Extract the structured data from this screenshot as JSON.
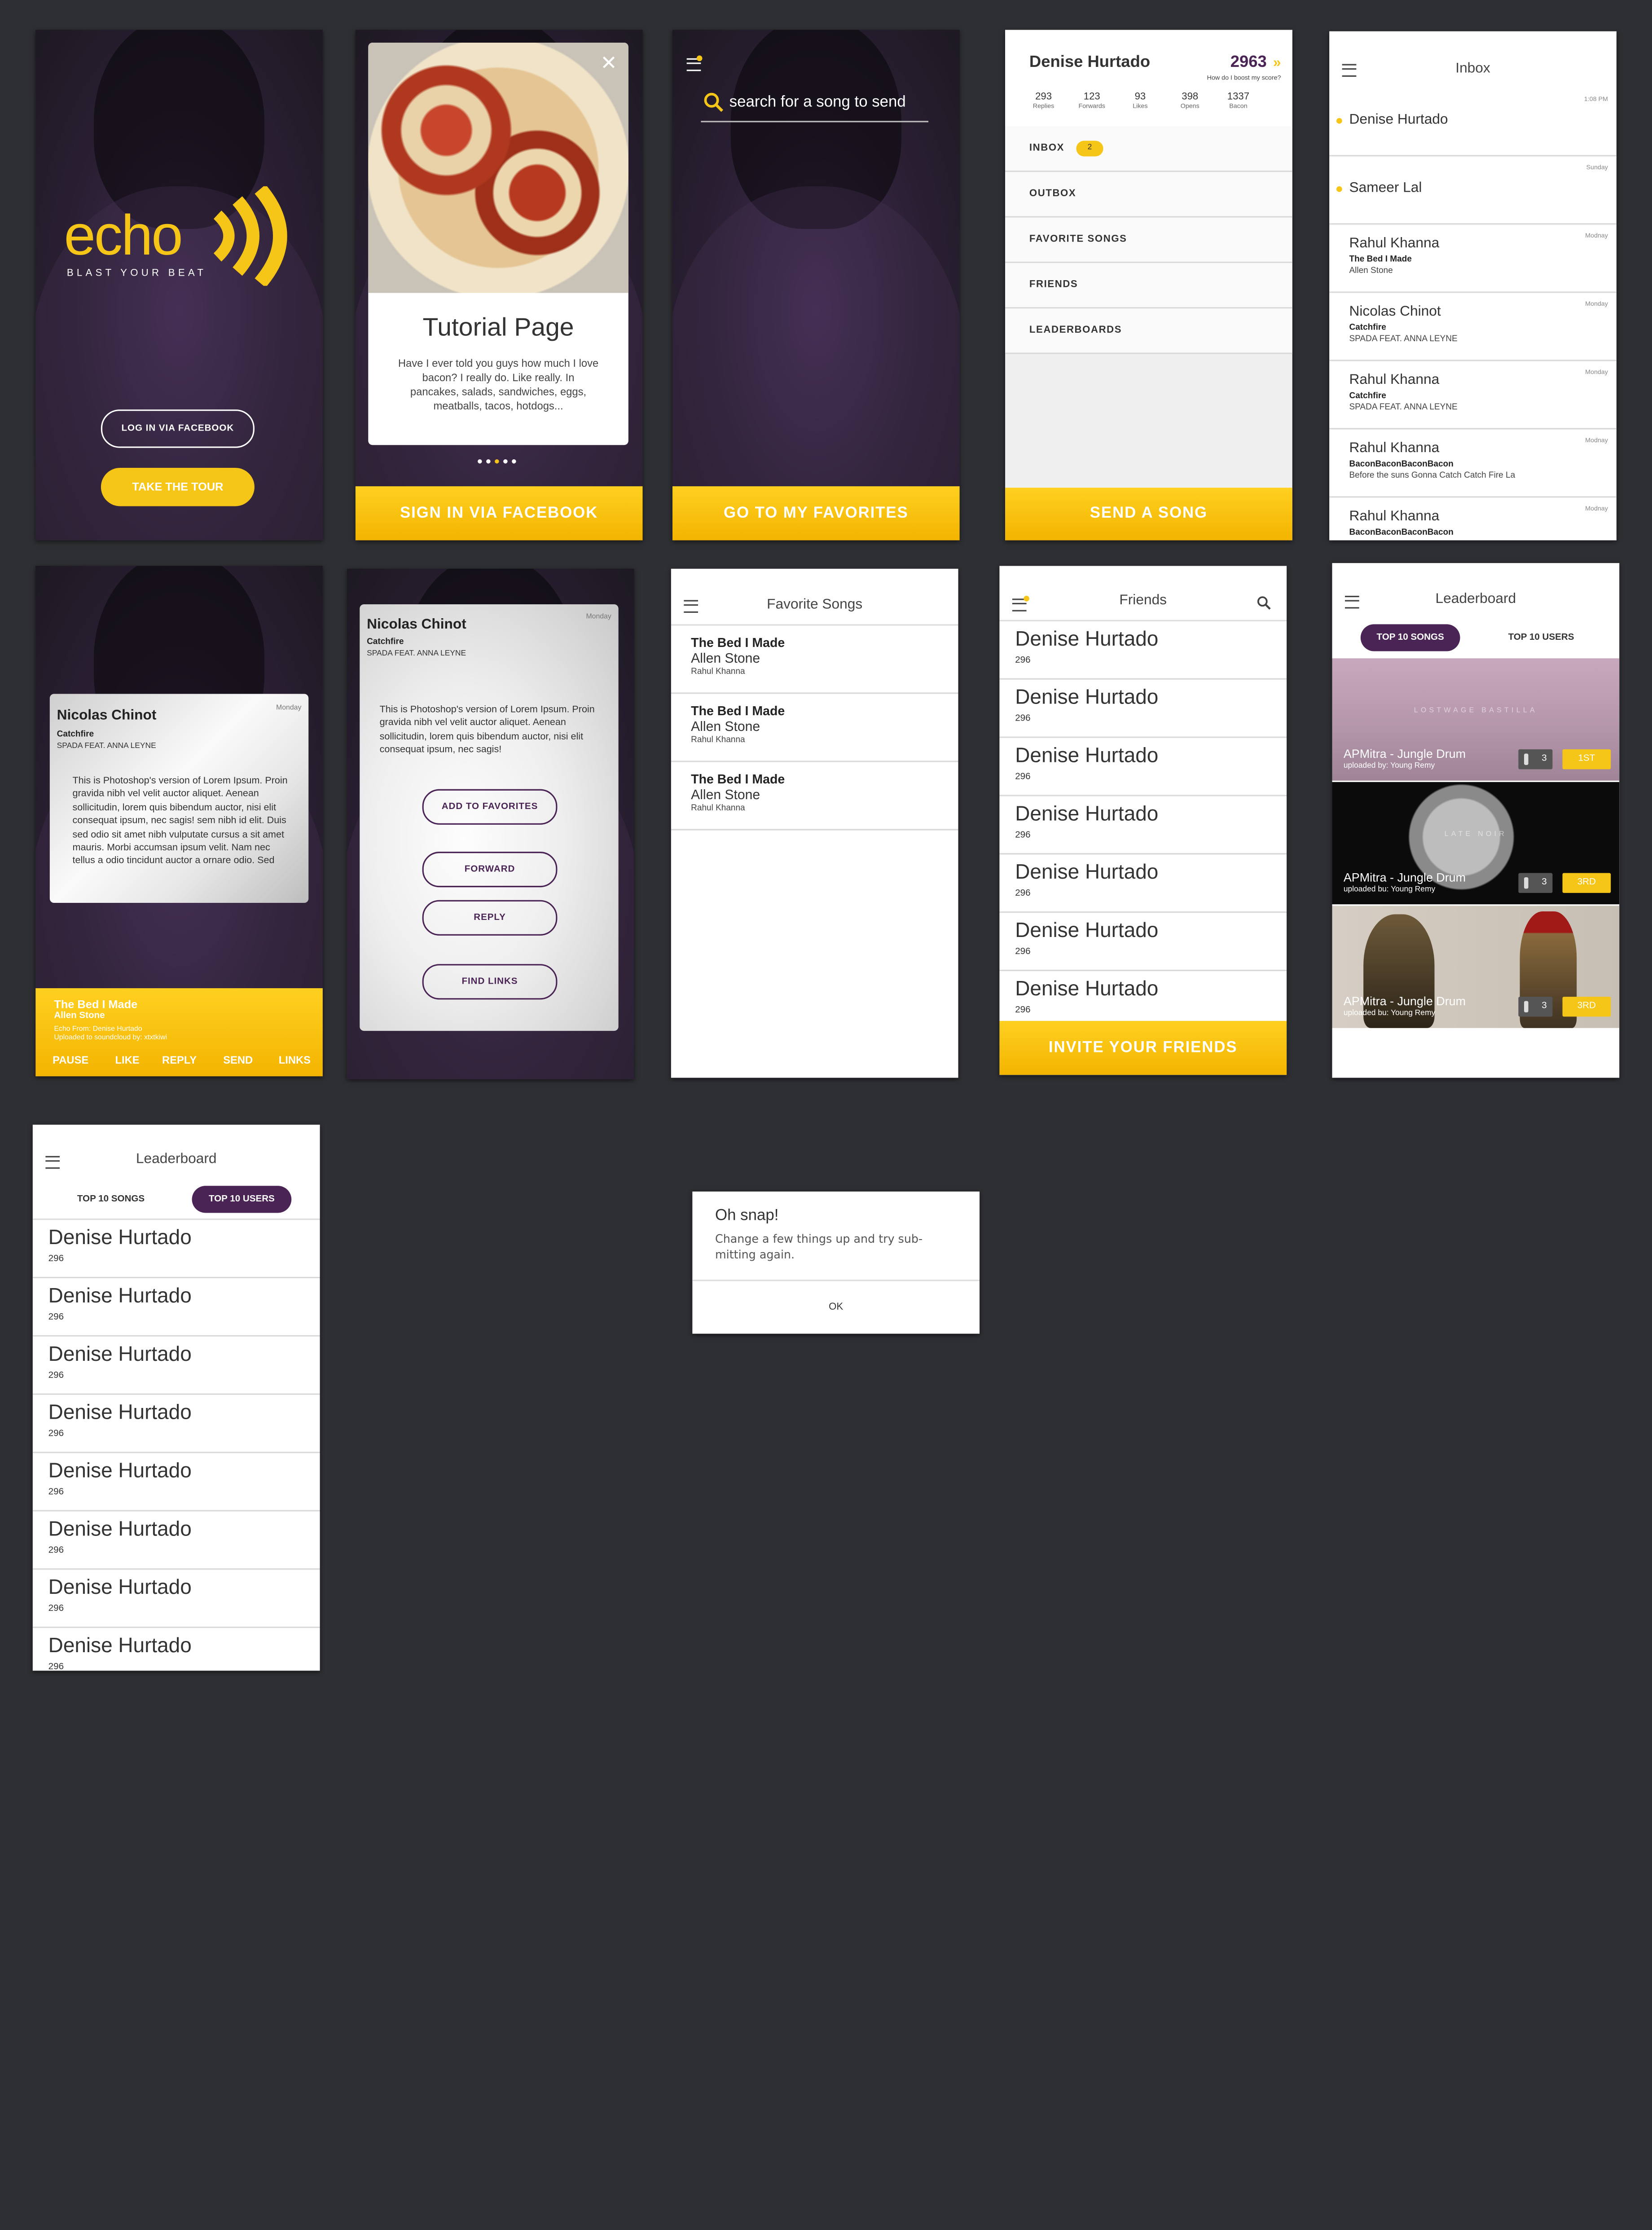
{
  "colors": {
    "accent": "#f5c518",
    "brand_purple": "#4a2454",
    "canvas": "#2e2f33"
  },
  "login": {
    "logo_word": "echo",
    "tagline": "BLAST YOUR BEAT",
    "facebook_button": "LOG IN VIA FACEBOOK",
    "tour_button": "TAKE THE TOUR"
  },
  "tutorial": {
    "title": "Tutorial Page",
    "body": "Have I ever told you guys how much I love bacon? I really do. Like really. In pancakes, salads, sandwiches, eggs, meatballs, tacos, hotdogs...",
    "close_icon": "close-icon",
    "page_dots": 5,
    "cta": "SIGN IN VIA FACEBOOK"
  },
  "search": {
    "placeholder": "search for a song to send",
    "cta": "GO TO MY FAVORITES"
  },
  "menu": {
    "user": "Denise Hurtado",
    "score": "2963",
    "score_hint": "How do I boost my score?",
    "stats": [
      {
        "value": "293",
        "label": "Replies"
      },
      {
        "value": "123",
        "label": "Forwards"
      },
      {
        "value": "93",
        "label": "Likes"
      },
      {
        "value": "398",
        "label": "Opens"
      },
      {
        "value": "1337",
        "label": "Bacon"
      }
    ],
    "items": [
      "INBOX",
      "OUTBOX",
      "FAVORITE SONGS",
      "FRIENDS",
      "LEADERBOARDS"
    ],
    "inbox_badge": "2",
    "cta": "SEND A SONG"
  },
  "inbox": {
    "title": "Inbox",
    "items": [
      {
        "name": "Denise Hurtado",
        "time": "1:08 PM",
        "song": "",
        "artist": "",
        "unread": true
      },
      {
        "name": "Sameer Lal",
        "time": "Sunday",
        "song": "",
        "artist": "",
        "unread": true
      },
      {
        "name": "Rahul Khanna",
        "time": "Modnay",
        "song": "The Bed I Made",
        "artist": "Allen Stone",
        "unread": false
      },
      {
        "name": "Nicolas Chinot",
        "time": "Monday",
        "song": "Catchfire",
        "artist": "SPADA FEAT. ANNA LEYNE",
        "unread": false
      },
      {
        "name": "Rahul Khanna",
        "time": "Monday",
        "song": "Catchfire",
        "artist": "SPADA FEAT. ANNA LEYNE",
        "unread": false
      },
      {
        "name": "Rahul Khanna",
        "time": "Modnay",
        "song": "BaconBaconBaconBacon",
        "artist": "Before the suns Gonna Catch Catch Fire La",
        "unread": false
      },
      {
        "name": "Rahul Khanna",
        "time": "Modnay",
        "song": "BaconBaconBaconBacon",
        "artist": "",
        "unread": false
      }
    ]
  },
  "message": {
    "name": "Nicolas Chinot",
    "day": "Monday",
    "song": "Catchfire",
    "artist": "SPADA FEAT. ANNA LEYNE",
    "body": "This is Photoshop's version  of Lorem Ipsum. Proin gravida nibh vel velit auctor aliquet. Aenean sollicitudin, lorem quis bibendum auctor, nisi elit consequat ipsum, nec sagis! sem nibh id elit. Duis sed odio sit amet nibh vulputate cursus a sit amet mauris. Morbi accumsan ipsum velit. Nam nec tellus a odio tincidunt auctor a ornare odio. Sed",
    "player": {
      "song": "The Bed I Made",
      "artist": "Allen Stone",
      "from": "Echo From: Denise Hurtado",
      "uploaded": "Uploaded to soundcloud by: xtxtkiwi",
      "controls": [
        "PAUSE",
        "LIKE",
        "REPLY",
        "SEND",
        "LINKS"
      ]
    }
  },
  "options": {
    "name": "Nicolas Chinot",
    "day": "Monday",
    "song": "Catchfire",
    "artist": "SPADA FEAT. ANNA LEYNE",
    "body": "This is Photoshop's version  of Lorem Ipsum. Proin gravida nibh vel velit auctor aliquet. Aenean sollicitudin, lorem quis bibendum auctor, nisi elit consequat ipsum, nec sagis!",
    "buttons": [
      "ADD TO FAVORITES",
      "FORWARD",
      "REPLY",
      "FIND LINKS"
    ]
  },
  "favorites": {
    "title": "Favorite Songs",
    "items": [
      {
        "song": "The Bed I Made",
        "artist": "Allen Stone",
        "by": "Rahul Khanna"
      },
      {
        "song": "The Bed I Made",
        "artist": "Allen Stone",
        "by": "Rahul Khanna"
      },
      {
        "song": "The Bed I Made",
        "artist": "Allen Stone",
        "by": "Rahul Khanna"
      }
    ]
  },
  "friends": {
    "title": "Friends",
    "items": [
      {
        "name": "Denise Hurtado",
        "score": "296"
      },
      {
        "name": "Denise Hurtado",
        "score": "296"
      },
      {
        "name": "Denise Hurtado",
        "score": "296"
      },
      {
        "name": "Denise Hurtado",
        "score": "296"
      },
      {
        "name": "Denise Hurtado",
        "score": "296"
      },
      {
        "name": "Denise Hurtado",
        "score": "296"
      },
      {
        "name": "Denise Hurtado",
        "score": "296"
      }
    ],
    "cta": "INVITE YOUR FRIENDS"
  },
  "leaderboard_songs": {
    "title": "Leaderboard",
    "tabs": [
      "TOP 10 SONGS",
      "TOP 10 USERS"
    ],
    "entries": [
      {
        "title": "APMitra - Jungle Drum",
        "uploader": "uploaded by: Young Remy",
        "count": "3",
        "rank": "1ST",
        "art_text": "LOSTWAGE BASTILLA"
      },
      {
        "title": "APMitra - Jungle Drum",
        "uploader": "uploaded bu: Young Remy",
        "count": "3",
        "rank": "3RD",
        "art_text": "LATE NOIR"
      },
      {
        "title": "APMitra - Jungle Drum",
        "uploader": "uploaded bu: Young Remy",
        "count": "3",
        "rank": "3RD",
        "art_text": ""
      }
    ]
  },
  "leaderboard_users": {
    "title": "Leaderboard",
    "tabs": [
      "TOP 10 SONGS",
      "TOP 10 USERS"
    ],
    "items": [
      {
        "name": "Denise Hurtado",
        "score": "296"
      },
      {
        "name": "Denise Hurtado",
        "score": "296"
      },
      {
        "name": "Denise Hurtado",
        "score": "296"
      },
      {
        "name": "Denise Hurtado",
        "score": "296"
      },
      {
        "name": "Denise Hurtado",
        "score": "296"
      },
      {
        "name": "Denise Hurtado",
        "score": "296"
      },
      {
        "name": "Denise Hurtado",
        "score": "296"
      },
      {
        "name": "Denise Hurtado",
        "score": "296"
      }
    ]
  },
  "alert": {
    "title": "Oh snap!",
    "body": "Change a few things up and try sub-mitting again.",
    "ok": "OK"
  }
}
